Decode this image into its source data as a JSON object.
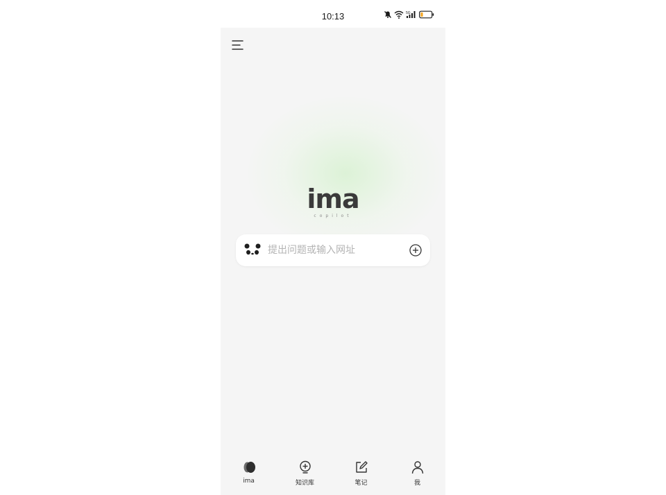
{
  "status_bar": {
    "time": "10:13",
    "icons": [
      "mute-icon",
      "wifi-icon",
      "signal-5g-icon",
      "battery-low-icon"
    ]
  },
  "header": {
    "menu_icon": "hamburger-menu-icon"
  },
  "logo": {
    "brand": "ima",
    "tagline": "copilot"
  },
  "search": {
    "placeholder": "提出问题或输入网址",
    "value": "",
    "leading_icon": "panda-icon",
    "trailing_icon": "add-circle-icon"
  },
  "tabs": [
    {
      "label": "ima",
      "icon": "ima-logo-icon",
      "active": true
    },
    {
      "label": "知识库",
      "icon": "bulb-plus-icon",
      "active": false
    },
    {
      "label": "笔记",
      "icon": "edit-note-icon",
      "active": false
    },
    {
      "label": "我",
      "icon": "user-icon",
      "active": false
    }
  ],
  "colors": {
    "background": "#f5f5f5",
    "glow": "#c8f0be",
    "brand_text": "#3a3a3a",
    "battery_low": "#f5a623"
  }
}
